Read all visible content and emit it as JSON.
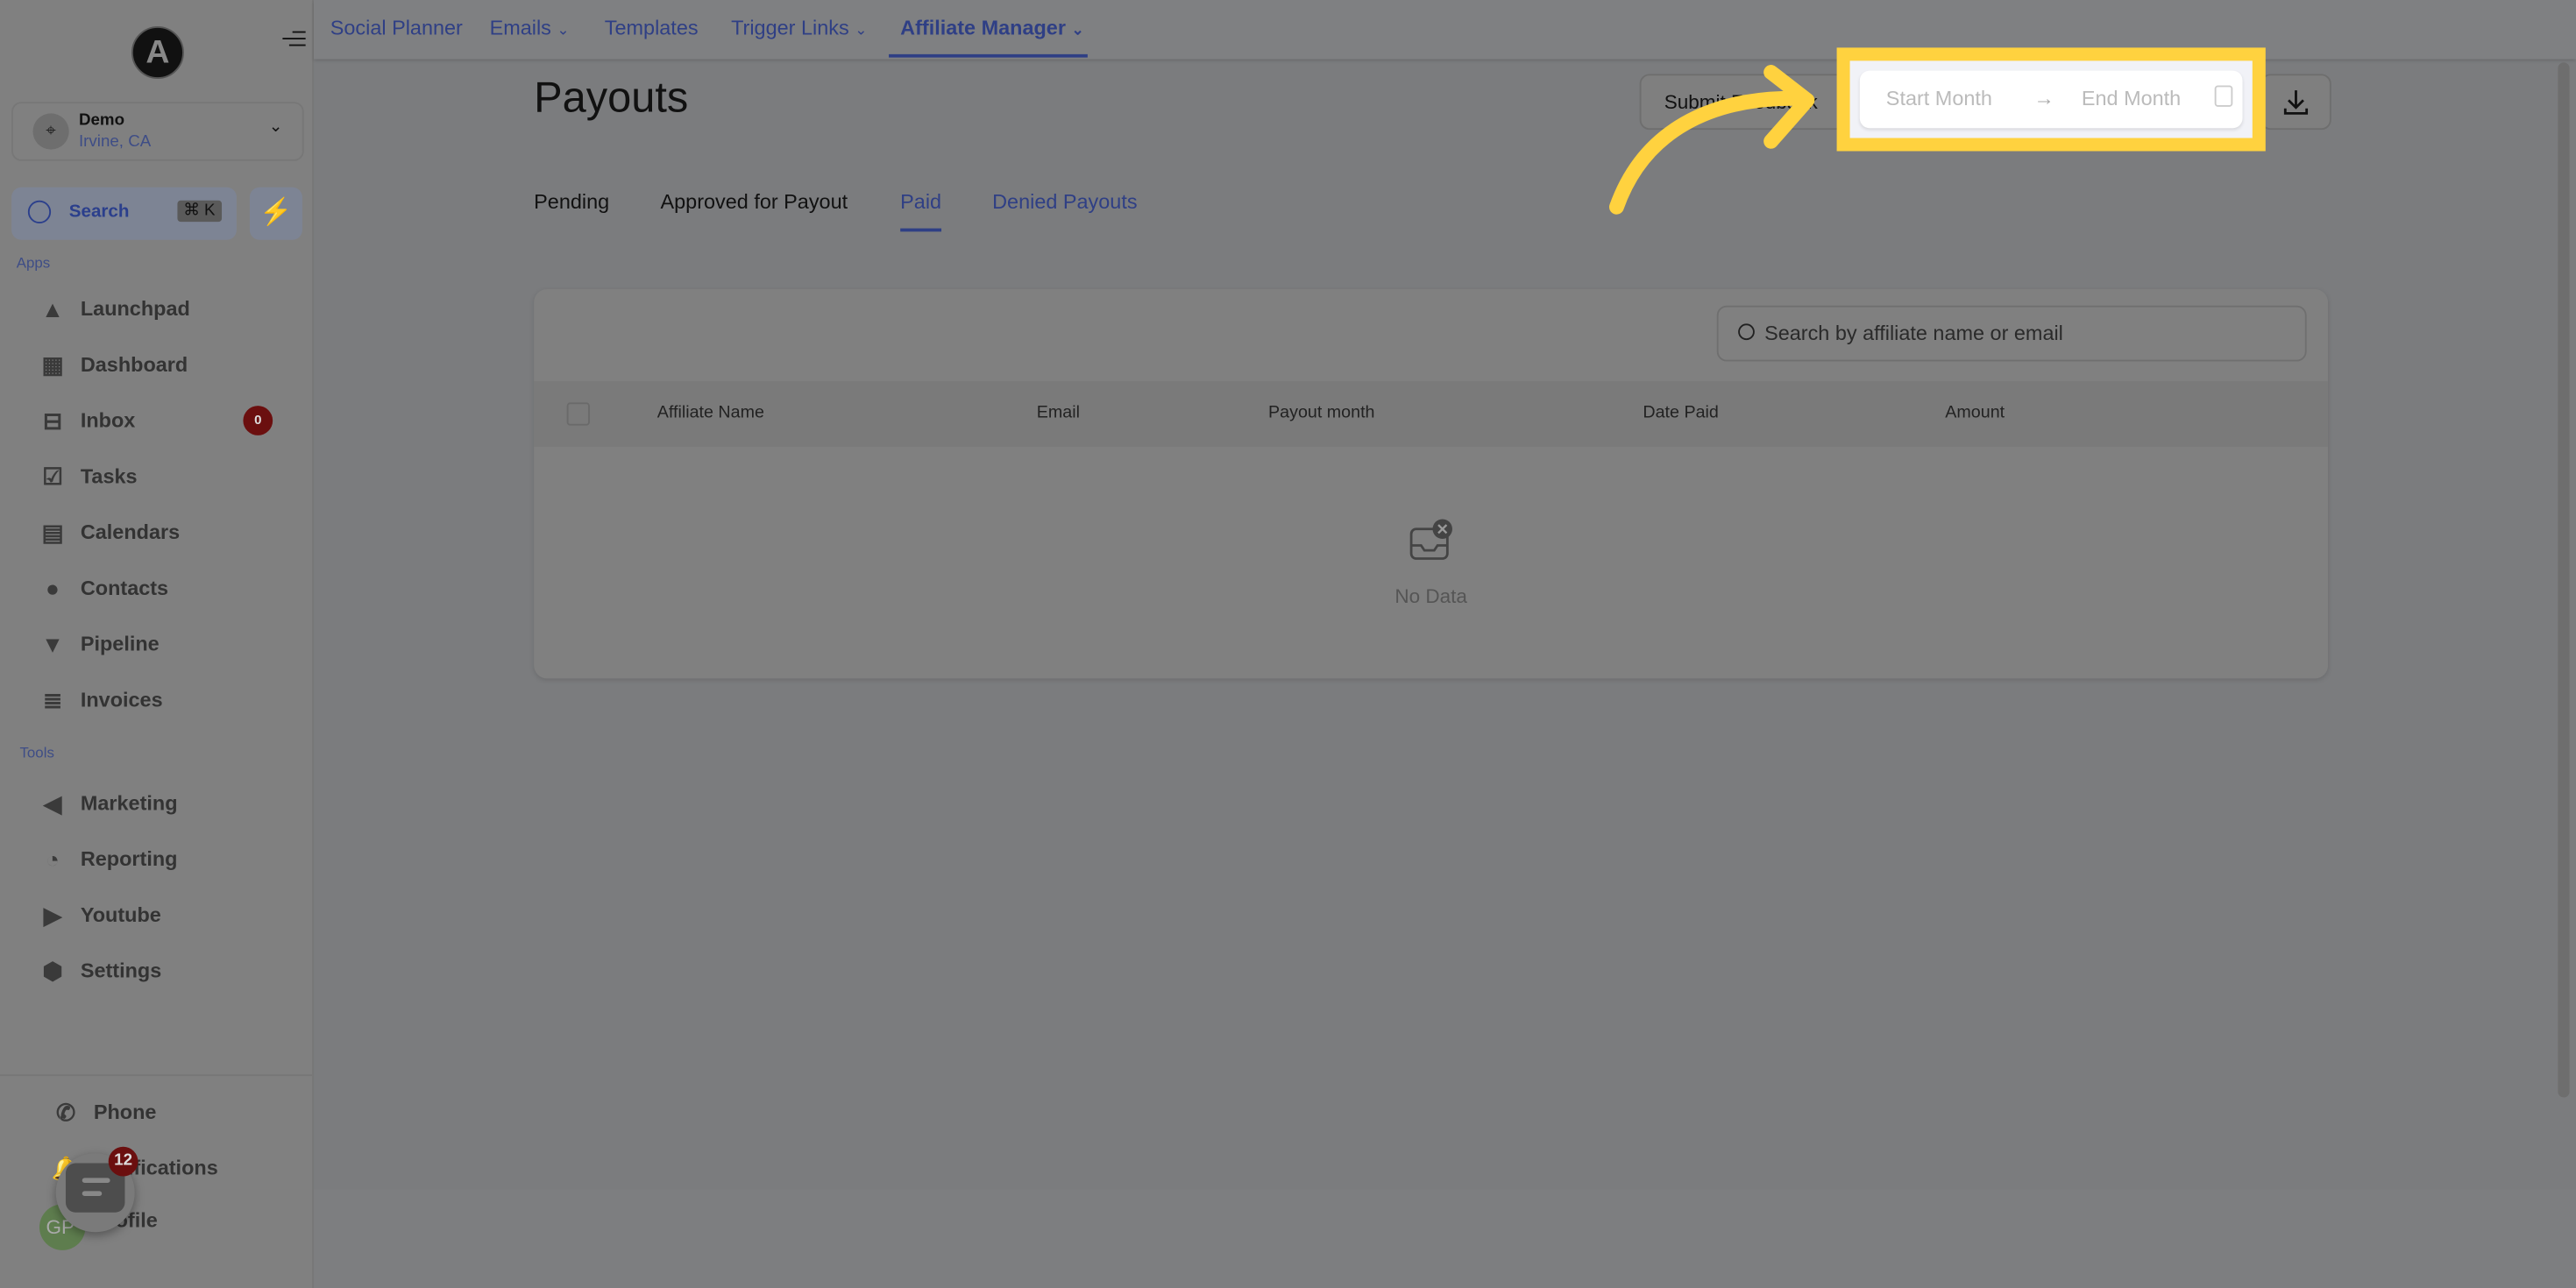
{
  "sidebar": {
    "logo_letter": "A",
    "location": {
      "name": "Demo",
      "city": "Irvine, CA"
    },
    "search": {
      "label": "Search",
      "shortcut": "⌘ K"
    },
    "sections": {
      "apps": "Apps",
      "tools": "Tools"
    },
    "apps": [
      {
        "label": "Launchpad",
        "icon": "rocket-icon"
      },
      {
        "label": "Dashboard",
        "icon": "dashboard-icon"
      },
      {
        "label": "Inbox",
        "icon": "inbox-icon",
        "badge": "0"
      },
      {
        "label": "Tasks",
        "icon": "tasks-icon"
      },
      {
        "label": "Calendars",
        "icon": "calendar-icon"
      },
      {
        "label": "Contacts",
        "icon": "contacts-icon"
      },
      {
        "label": "Pipeline",
        "icon": "funnel-icon"
      },
      {
        "label": "Invoices",
        "icon": "invoice-icon"
      }
    ],
    "tools": [
      {
        "label": "Marketing",
        "icon": "megaphone-icon"
      },
      {
        "label": "Reporting",
        "icon": "pie-chart-icon"
      },
      {
        "label": "Youtube",
        "icon": "youtube-icon"
      },
      {
        "label": "Settings",
        "icon": "gear-icon"
      }
    ],
    "bottom": [
      {
        "label": "Phone",
        "icon": "phone-icon"
      },
      {
        "label": "Notifications",
        "icon": "bell-icon"
      },
      {
        "label": "Profile",
        "avatar": "GP"
      }
    ],
    "chat_badge": "12"
  },
  "topnav": [
    {
      "label": "Social Planner"
    },
    {
      "label": "Emails",
      "dropdown": true
    },
    {
      "label": "Templates"
    },
    {
      "label": "Trigger Links",
      "dropdown": true
    },
    {
      "label": "Affiliate Manager",
      "dropdown": true,
      "active": true
    }
  ],
  "page": {
    "title": "Payouts",
    "feedback_label": "Submit Feedback",
    "date_range": {
      "start_placeholder": "Start Month",
      "end_placeholder": "End Month"
    },
    "tabs": [
      "Pending",
      "Approved for Payout",
      "Paid",
      "Denied Payouts"
    ],
    "active_tab": "Paid",
    "search_placeholder": "Search by affiliate name or email",
    "columns": [
      "Affiliate Name",
      "Email",
      "Payout month",
      "Date Paid",
      "Amount"
    ],
    "empty_text": "No Data"
  },
  "colors": {
    "accent": "#2f3f85",
    "highlight": "#ffd23f",
    "badge": "#6b0f0f"
  }
}
